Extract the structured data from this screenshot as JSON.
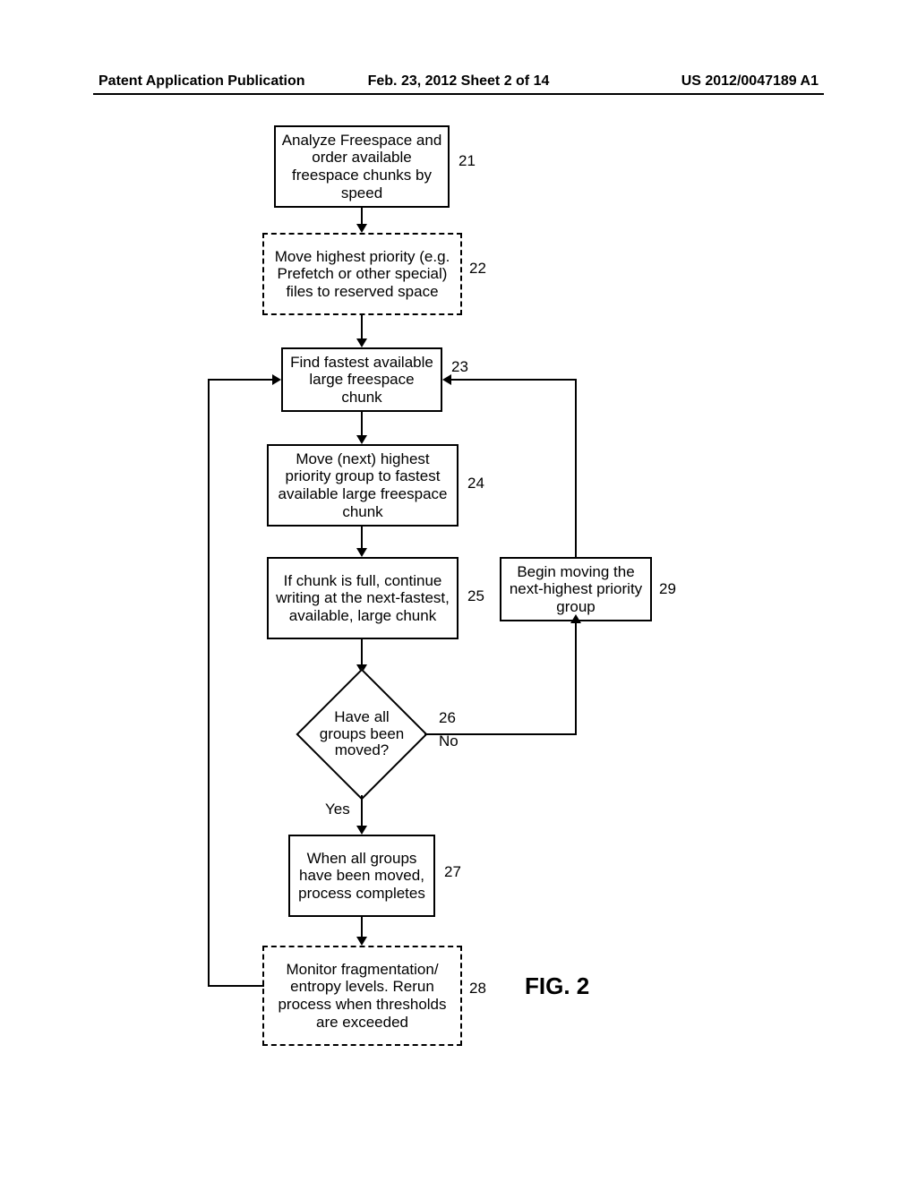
{
  "header": {
    "left": "Patent Application Publication",
    "center": "Feb. 23, 2012  Sheet 2 of 14",
    "right": "US 2012/0047189 A1"
  },
  "figure_label": "FIG. 2",
  "steps": {
    "s21": {
      "num": "21",
      "text": "Analyze Freespace and order available freespace chunks by speed"
    },
    "s22": {
      "num": "22",
      "text": "Move highest priority (e.g. Prefetch or other special) files to reserved space"
    },
    "s23": {
      "num": "23",
      "text": "Find fastest available large freespace chunk"
    },
    "s24": {
      "num": "24",
      "text": "Move (next) highest priority group to fastest available large freespace chunk"
    },
    "s25": {
      "num": "25",
      "text": "If chunk is full, continue writing at the next-fastest, available, large chunk"
    },
    "s26": {
      "num": "26",
      "text": "Have all groups been moved?",
      "yes": "Yes",
      "no": "No"
    },
    "s27": {
      "num": "27",
      "text": "When all groups have been moved, process completes"
    },
    "s28": {
      "num": "28",
      "text": "Monitor fragmentation/ entropy levels. Rerun process when thresholds are exceeded"
    },
    "s29": {
      "num": "29",
      "text": "Begin moving the next-highest priority group"
    }
  }
}
